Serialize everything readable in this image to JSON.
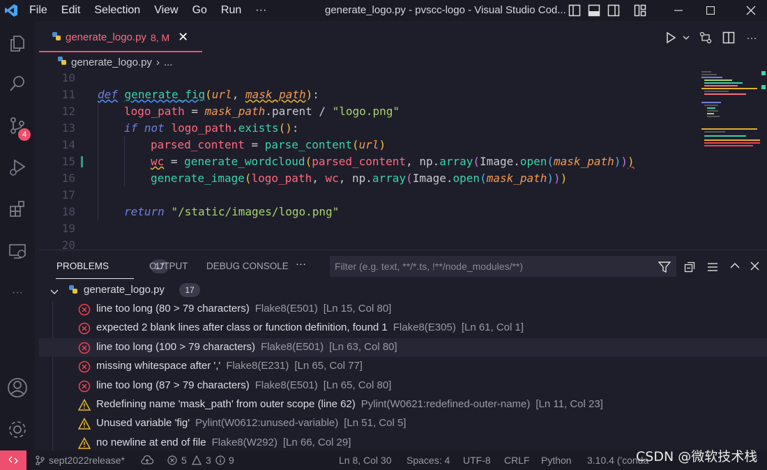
{
  "window": {
    "title": "generate_logo.py - pvscc-logo - Visual Studio Cod...",
    "menu": [
      "File",
      "Edit",
      "Selection",
      "View",
      "Go",
      "Run",
      "···"
    ]
  },
  "activity": {
    "scm_badge": "4",
    "more": "···"
  },
  "editor": {
    "tab": {
      "file": "generate_logo.py",
      "status": "8, M",
      "close": "✕"
    },
    "breadcrumb": {
      "file": "generate_logo.py",
      "rest": "..."
    },
    "line_numbers": [
      "10",
      "11",
      "12",
      "13",
      "14",
      "15",
      "16",
      "17",
      "18",
      "19",
      "20"
    ],
    "code": {
      "l11": {
        "def": "def",
        "fname": "generate_fig",
        "p1": "url",
        "p2": "mask_path"
      },
      "l12": {
        "var": "logo_path",
        "param": "mask_path",
        "attr": ".parent / ",
        "str": "\"logo.png\""
      },
      "l13": {
        "if": "if",
        "not": "not",
        "var": "logo_path",
        "method": "exists"
      },
      "l14": {
        "var": "parsed_content",
        "func": "parse_content",
        "arg": "url"
      },
      "l15": {
        "var": "wc",
        "func": "generate_wordcloud",
        "a1": "parsed_content",
        "np": "np",
        "array": "array",
        "img": "Image",
        "open": "open",
        "arg": "mask_path"
      },
      "l16": {
        "func": "generate_image",
        "a1": "logo_path",
        "a2": "wc",
        "np": "np",
        "array": "array",
        "img": "Image",
        "open": "open",
        "arg": "mask_path"
      },
      "l18": {
        "ret": "return",
        "str": "\"/static/images/logo.png\""
      }
    }
  },
  "panel": {
    "tabs": [
      {
        "label": "PROBLEMS",
        "count": "17"
      },
      {
        "label": "OUTPUT"
      },
      {
        "label": "DEBUG CONSOLE"
      }
    ],
    "more": "···",
    "filter_placeholder": "Filter (e.g. text, **/*.ts, !**/node_modules/**)",
    "file_group": {
      "name": "generate_logo.py",
      "count": "17"
    },
    "problems": [
      {
        "severity": "error",
        "message": "line too long (80 > 79 characters)",
        "source": "Flake8(E501)",
        "location": "[Ln 15, Col 80]"
      },
      {
        "severity": "error",
        "message": "expected 2 blank lines after class or function definition, found 1",
        "source": "Flake8(E305)",
        "location": "[Ln 61, Col 1]"
      },
      {
        "severity": "error",
        "message": "line too long (100 > 79 characters)",
        "source": "Flake8(E501)",
        "location": "[Ln 63, Col 80]"
      },
      {
        "severity": "error",
        "message": "missing whitespace after ','",
        "source": "Flake8(E231)",
        "location": "[Ln 65, Col 77]"
      },
      {
        "severity": "error",
        "message": "line too long (87 > 79 characters)",
        "source": "Flake8(E501)",
        "location": "[Ln 65, Col 80]"
      },
      {
        "severity": "warning",
        "message": "Redefining name 'mask_path' from outer scope (line 62)",
        "source": "Pylint(W0621:redefined-outer-name)",
        "location": "[Ln 11, Col 23]"
      },
      {
        "severity": "warning",
        "message": "Unused variable 'fig'",
        "source": "Pylint(W0612:unused-variable)",
        "location": "[Ln 51, Col 5]"
      },
      {
        "severity": "warning",
        "message": "no newline at end of file",
        "source": "Flake8(W292)",
        "location": "[Ln 66, Col 29]"
      }
    ]
  },
  "status": {
    "branch": "sept2022release*",
    "errors": "5",
    "warnings": "3",
    "infos": "9",
    "position": "Ln 8, Col 30",
    "spaces": "Spaces: 4",
    "encoding": "UTF-8",
    "eol": "CRLF",
    "language": "Python",
    "interpreter": "3.10.4 ('conda"
  },
  "watermark": "CSDN @微软技术栈",
  "colors": {
    "accent": "#ee4f6e",
    "background": "#1e1e2a",
    "error": "#f04050",
    "warning": "#e8b830"
  }
}
